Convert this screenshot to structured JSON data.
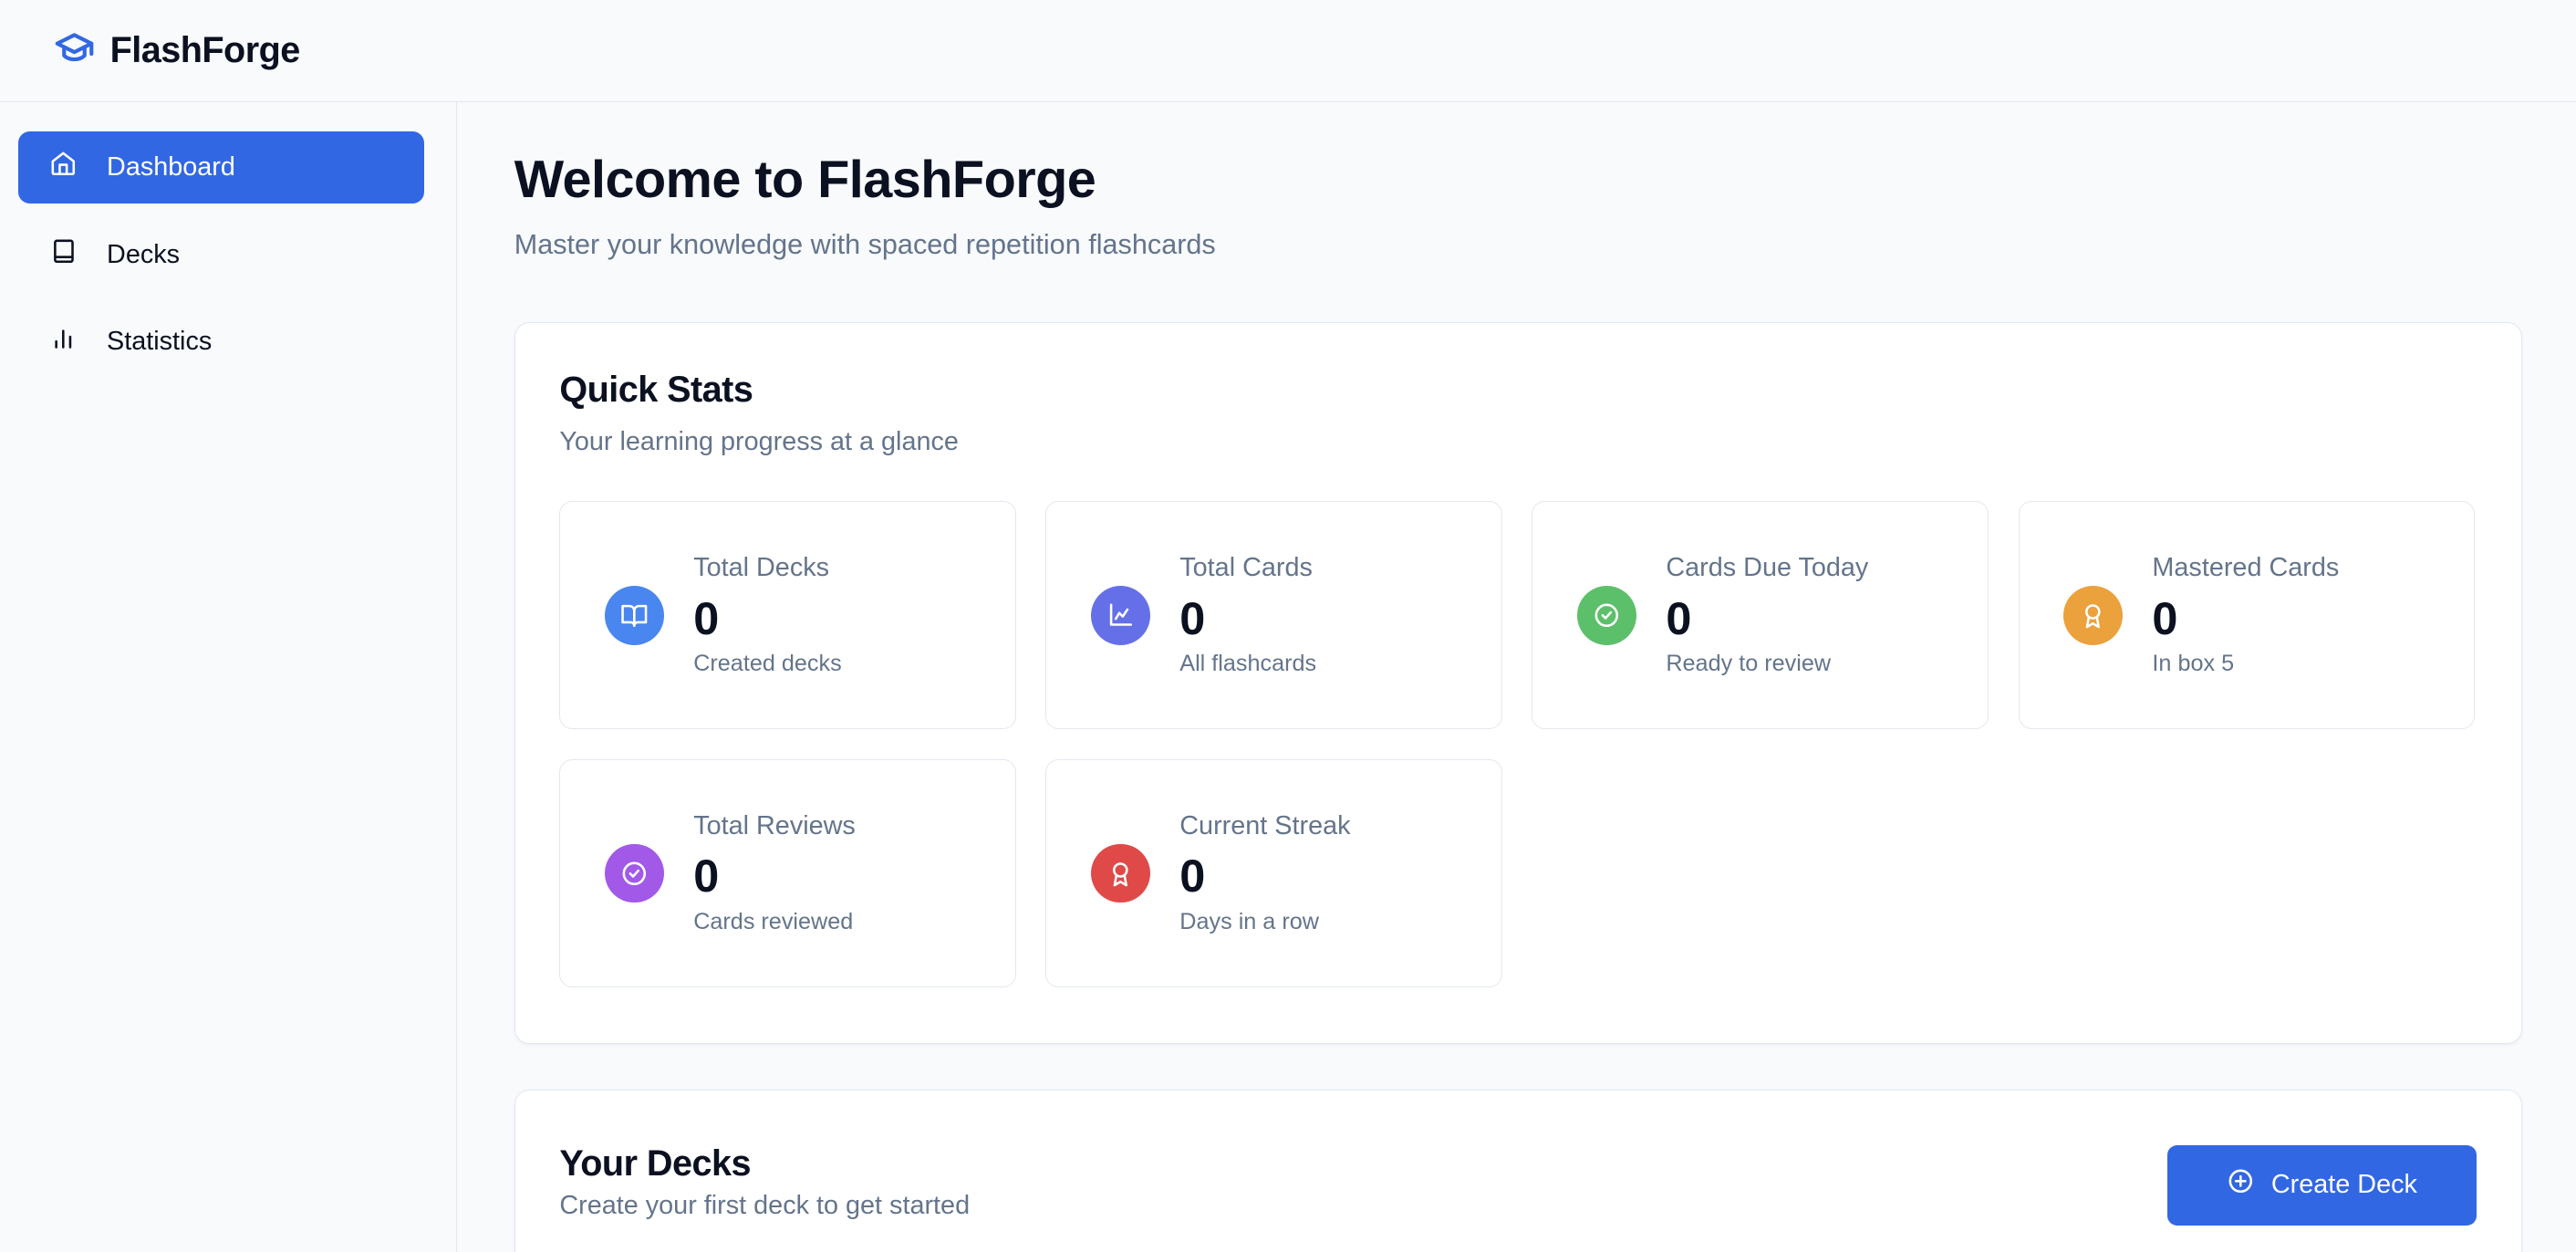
{
  "app": {
    "name": "FlashForge",
    "logo_icon": "graduation-cap-icon"
  },
  "sidebar": {
    "items": [
      {
        "label": "Dashboard",
        "icon": "home-icon",
        "active": true
      },
      {
        "label": "Decks",
        "icon": "book-icon"
      },
      {
        "label": "Statistics",
        "icon": "bar-chart-icon"
      }
    ]
  },
  "main": {
    "title": "Welcome to FlashForge",
    "subtitle": "Master your knowledge with spaced repetition flashcards"
  },
  "quick_stats": {
    "title": "Quick Stats",
    "subtitle": "Your learning progress at a glance",
    "stats": [
      {
        "label": "Total Decks",
        "value": "0",
        "desc": "Created decks",
        "icon": "book-open-icon",
        "color": "#4a86ef"
      },
      {
        "label": "Total Cards",
        "value": "0",
        "desc": "All flashcards",
        "icon": "line-chart-icon",
        "color": "#6570e8"
      },
      {
        "label": "Cards Due Today",
        "value": "0",
        "desc": "Ready to review",
        "icon": "check-circle-icon",
        "color": "#5cc06b"
      },
      {
        "label": "Mastered Cards",
        "value": "0",
        "desc": "In box 5",
        "icon": "award-icon",
        "color": "#eba13c"
      },
      {
        "label": "Total Reviews",
        "value": "0",
        "desc": "Cards reviewed",
        "icon": "check-circle-icon",
        "color": "#a259e8"
      },
      {
        "label": "Current Streak",
        "value": "0",
        "desc": "Days in a row",
        "icon": "award-icon",
        "color": "#df4a48"
      }
    ]
  },
  "decks": {
    "title": "Your Decks",
    "subtitle": "Create your first deck to get started",
    "create_label": "Create Deck"
  }
}
